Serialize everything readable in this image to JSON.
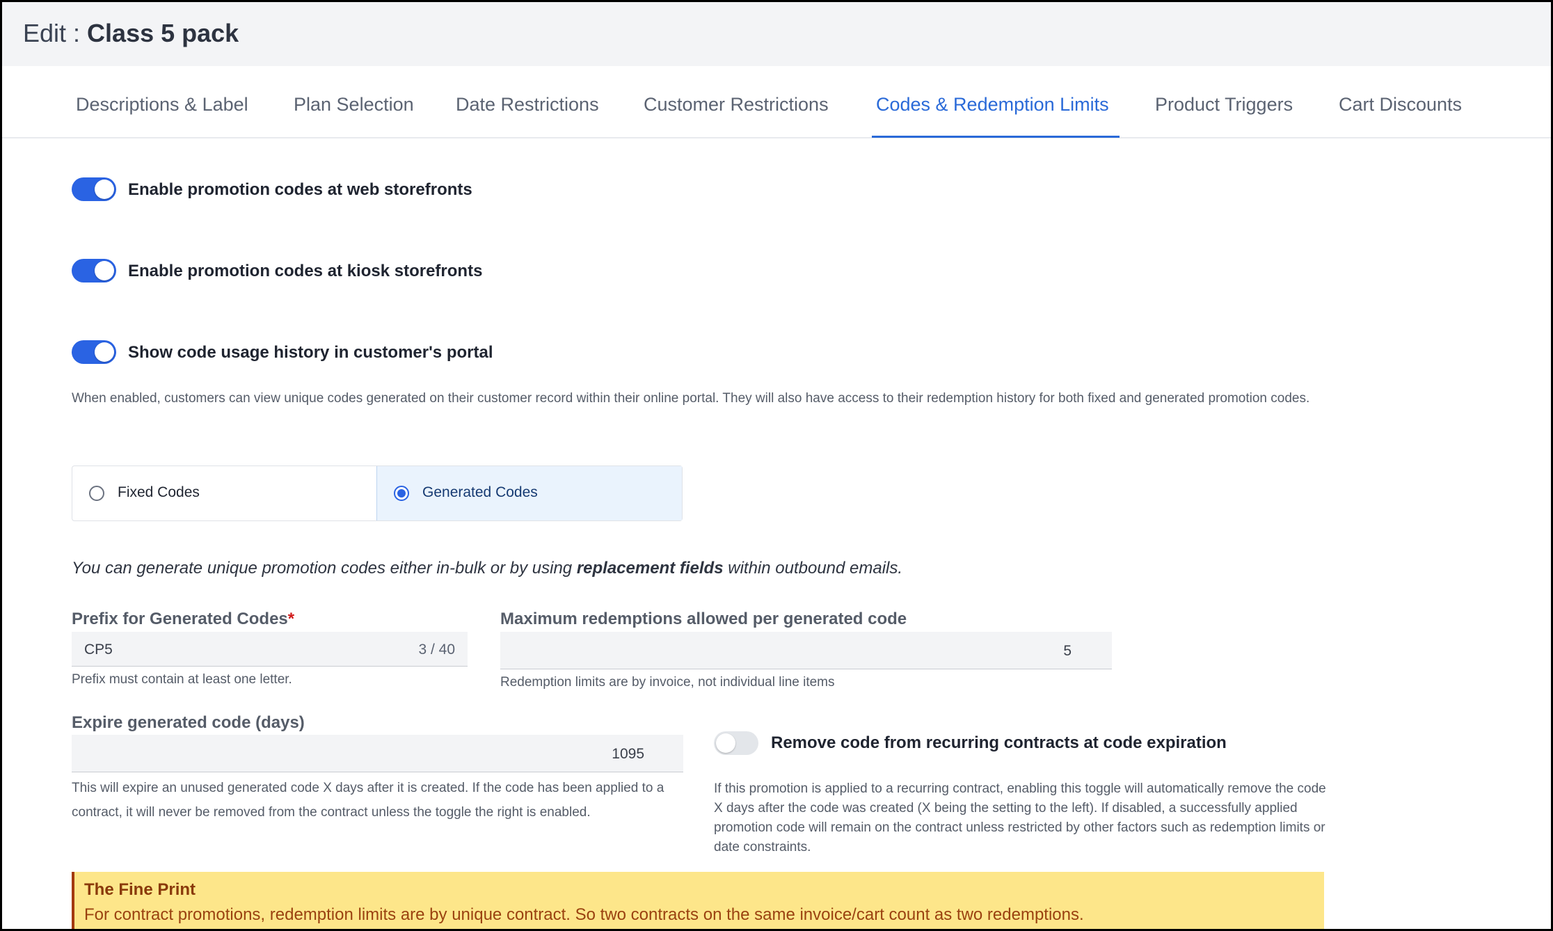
{
  "header": {
    "prefix": "Edit : ",
    "name": "Class 5 pack"
  },
  "tabs": [
    {
      "label": "Descriptions & Label"
    },
    {
      "label": "Plan Selection"
    },
    {
      "label": "Date Restrictions"
    },
    {
      "label": "Customer Restrictions"
    },
    {
      "label": "Codes & Redemption Limits",
      "active": true
    },
    {
      "label": "Product Triggers"
    },
    {
      "label": "Cart Discounts"
    }
  ],
  "toggles": {
    "web": {
      "label": "Enable promotion codes at web storefronts",
      "on": true
    },
    "kiosk": {
      "label": "Enable promotion codes at kiosk storefronts",
      "on": true
    },
    "history": {
      "label": "Show code usage history in customer's portal",
      "on": true
    }
  },
  "history_help": "When enabled, customers can view unique codes generated on their customer record within their online portal. They will also have access to their redemption history for both fixed and generated promotion codes.",
  "code_type": {
    "options": [
      "Fixed Codes",
      "Generated Codes"
    ],
    "selected": "Generated Codes"
  },
  "intro": {
    "before": "You can generate unique promotion codes either in-bulk or by using ",
    "bold": "replacement fields",
    "after": " within outbound emails."
  },
  "prefix_field": {
    "label": "Prefix for Generated Codes",
    "required_mark": "*",
    "value": "CP5",
    "counter": "3 / 40",
    "help": "Prefix must contain at least one letter."
  },
  "max_redemptions_field": {
    "label": "Maximum redemptions allowed per generated code",
    "value": "5",
    "help": "Redemption limits are by invoice, not individual line items"
  },
  "expire_field": {
    "label": "Expire generated code (days)",
    "value": "1095",
    "help": "This will expire an unused generated code X days after it is created. If the code has been applied to a contract, it will never be removed from the contract unless the toggle the right is enabled."
  },
  "remove_toggle": {
    "label": "Remove code from recurring contracts at code expiration",
    "on": false,
    "help": "If this promotion is applied to a recurring contract, enabling this toggle will automatically remove the code X days after the code was created (X being the setting to the left). If disabled, a successfully applied promotion code will remain on the contract unless restricted by other factors such as redemption limits or date constraints."
  },
  "fine_print": {
    "title": "The Fine Print",
    "body": "For contract promotions, redemption limits are by unique contract. So two contracts on the same invoice/cart count as two redemptions."
  },
  "colors": {
    "accent": "#2a63e3",
    "warning_bg": "#fde68a",
    "warning_text": "#9a4210"
  }
}
